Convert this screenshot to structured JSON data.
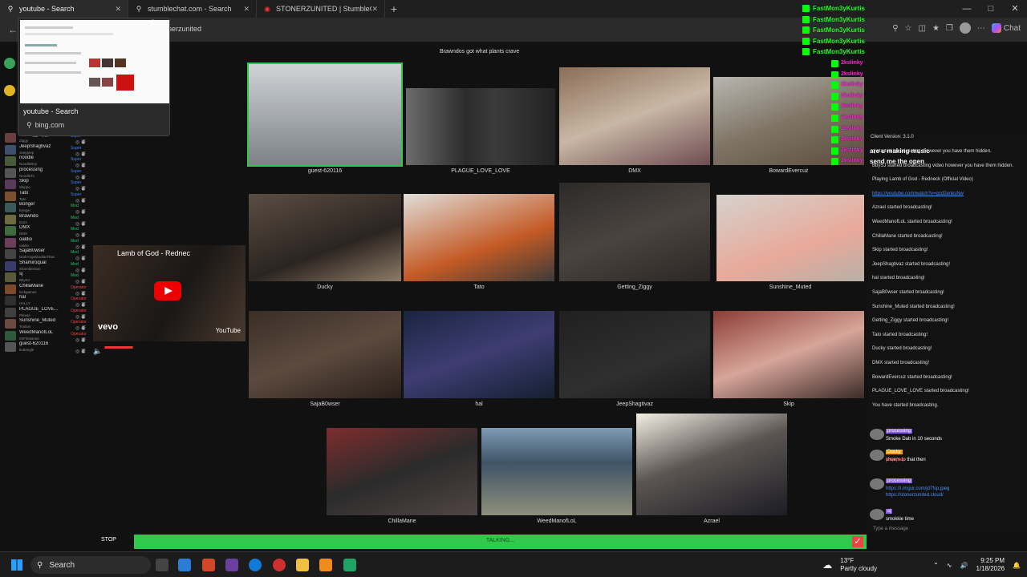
{
  "browser": {
    "tabs": [
      {
        "label": "youtube - Search",
        "icon": "search-icon"
      },
      {
        "label": "stumblechat.com - Search",
        "icon": "search-icon"
      },
      {
        "label": "STONERZUNITED | StumbleChat",
        "icon": "record-icon"
      }
    ],
    "new_tab": "+",
    "url_fragment": "onerzunited",
    "copilot_label": "Chat"
  },
  "tab_preview": {
    "title": "youtube - Search",
    "url": "bing.com"
  },
  "room": {
    "banner": "Brawndos got what plants crave",
    "users": [
      {
        "name": "Getting_Ziggy",
        "sub": "Ziggy",
        "role": "Super"
      },
      {
        "name": "JeepShagtivaz",
        "sub": "Jeepjeep",
        "role": "Super"
      },
      {
        "name": "noodle",
        "sub": "NoodleBoy",
        "role": "Super"
      },
      {
        "name": "processing",
        "sub": "NoodleTo",
        "role": "Super"
      },
      {
        "name": "Skip",
        "sub": "Skippo",
        "role": "Super"
      },
      {
        "name": "Tato",
        "sub": "Tato",
        "role": "Super"
      },
      {
        "name": "Bonger",
        "sub": "bonger",
        "role": "Mod"
      },
      {
        "name": "Brawndo",
        "sub": "Its24",
        "role": "Mod"
      },
      {
        "name": "DMX",
        "sub": "DMX",
        "role": "Mod"
      },
      {
        "name": "oaldio",
        "sub": "oaldio",
        "role": "Mod"
      },
      {
        "name": "SajaB0wser",
        "sub": "DarkAngelZodiacFlaw",
        "role": "Mod"
      },
      {
        "name": "Shamiroqual",
        "sub": "Shambleriam",
        "role": "Mod"
      },
      {
        "name": "sj",
        "sub": "BbySJ",
        "role": "Mod"
      },
      {
        "name": "ChillaMane",
        "sub": "luckgames",
        "role": "Operator"
      },
      {
        "name": "hal",
        "sub": "HALLY",
        "role": "Operator"
      },
      {
        "name": "PLAGUE_LOVE...",
        "sub": "Please",
        "role": "Operator"
      },
      {
        "name": "Sunshine_Muted",
        "sub": "Toolam",
        "role": "Operator"
      },
      {
        "name": "WeedManofLoL",
        "sub": "MrFlintstone",
        "role": "Operator"
      },
      {
        "name": "guest-620116",
        "sub": "kuttangle",
        "role": ""
      }
    ],
    "cams": [
      {
        "label": "guest-620116"
      },
      {
        "label": "PLAGUE_LOVE_LOVE"
      },
      {
        "label": "DMX"
      },
      {
        "label": "BowardEvercuz"
      },
      {
        "label": "Ducky"
      },
      {
        "label": "Tato"
      },
      {
        "label": "Getting_Ziggy"
      },
      {
        "label": "Sunshine_Muted"
      },
      {
        "label": "SajaB0wser"
      },
      {
        "label": "hal"
      },
      {
        "label": "JeepShagtivaz"
      },
      {
        "label": "Skip"
      },
      {
        "label": "ChillaMane"
      },
      {
        "label": "WeedManofLoL"
      },
      {
        "label": "Azrael"
      }
    ]
  },
  "youtube": {
    "title": "Lamb of God - Rednec",
    "brand": "vevo",
    "logo": "YouTube"
  },
  "overlay": {
    "green": [
      "FastMon3yKurtis",
      "FastMon3yKurtis",
      "FastMon3yKurtis",
      "FastMon3yKurtis",
      "FastMon3yKurtis"
    ],
    "pink": [
      "2kslinky",
      "2kslinky",
      "2kslinky",
      "2kslinky",
      "2kslinky",
      "2kslinky",
      "2kslinky",
      "2kslinky",
      "2kslinky",
      "2kslinky"
    ],
    "music1": "are u making music",
    "music2": "send me the open"
  },
  "chat": {
    "version": "Client Version: 3.1.0",
    "system": [
      "sj started broadcasting. however you have them hidden.",
      "BbySJ started broadcasting video however you have them hidden.",
      "Playing Lamb of God - Redneck (Official Video)",
      "https://youtube.com/watch?v=gcd2enksNw",
      "Azrael started broadcasting!",
      "WeedManofLoL started broadcasting!",
      "ChillaMane started broadcasting!",
      "Skip started broadcasting!",
      "JeepShagtivaz started broadcasting!",
      "hal started broadcasting!",
      "SajaB0wser started broadcasting!",
      "Sunshine_Muted started broadcasting!",
      "Getting_Ziggy started broadcasting!",
      "Tato started broadcasting!",
      "Ducky started broadcasting!",
      "DMX started broadcasting!",
      "BowardEvercuz started broadcasting!",
      "PLAGUE_LOVE_LOVE started broadcasting!",
      "You have started broadcasting."
    ],
    "messages": [
      {
        "name": "processing",
        "text": "Smoke Dab in 10 seconds"
      },
      {
        "name": "Ducky",
        "text": "cheers to that then"
      },
      {
        "name": "",
        "text": "jeep jeep"
      },
      {
        "name": "processing",
        "text": "https://i.imgur.com/jd7fsp.jpeg"
      },
      {
        "name": "",
        "text": "https://stonerzunited.cloud/"
      },
      {
        "name": "sj",
        "text": "smokkie time"
      }
    ],
    "placeholder": "Type a message"
  },
  "controls": {
    "stop": "STOP",
    "talking": "TALKING..."
  },
  "taskbar": {
    "search": "Search",
    "temp": "13°F",
    "weather": "Partly cloudy",
    "time": "9:25 PM",
    "date": "1/18/2026"
  },
  "colors": {
    "talk_green": "#31c94b",
    "overlay_green": "#22ff22",
    "overlay_pink": "#ff2bd6",
    "link_blue": "#4b8ff7"
  }
}
